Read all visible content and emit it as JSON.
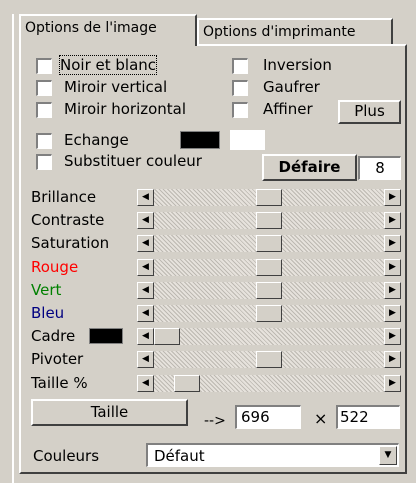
{
  "tabs": [
    {
      "label": "Options de l'image",
      "active": true
    },
    {
      "label": "Options d'imprimante",
      "active": false
    }
  ],
  "checkboxes": {
    "noir_et_blanc": "Noir et blanc",
    "inversion": "Inversion",
    "miroir_vertical": "Miroir vertical",
    "gaufrer": "Gaufrer",
    "miroir_horizontal": "Miroir horizontal",
    "affiner": "Affiner",
    "echange": "Echange",
    "substituer_couleur": "Substituer couleur"
  },
  "buttons": {
    "plus": "Plus",
    "defaire": "Défaire",
    "taille": "Taille"
  },
  "defaire_count": "8",
  "swatch_colors": {
    "echange_primary": "#000000",
    "echange_secondary": "#ffffff",
    "cadre": "#000000"
  },
  "sliders": [
    {
      "label": "Brillance",
      "color": "#000000",
      "value": 0.5
    },
    {
      "label": "Contraste",
      "color": "#000000",
      "value": 0.5
    },
    {
      "label": "Saturation",
      "color": "#000000",
      "value": 0.5
    },
    {
      "label": "Rouge",
      "color": "#ff0000",
      "value": 0.5
    },
    {
      "label": "Vert",
      "color": "#008000",
      "value": 0.5
    },
    {
      "label": "Bleu",
      "color": "#000080",
      "value": 0.5
    },
    {
      "label": "Cadre",
      "color": "#000000",
      "value": 0.0
    },
    {
      "label": "Pivoter",
      "color": "#000000",
      "value": 0.5
    },
    {
      "label": "Taille %",
      "color": "#000000",
      "value": 0.1
    }
  ],
  "size": {
    "arrow": "-->",
    "width": "696",
    "times": "×",
    "height": "522"
  },
  "couleurs": {
    "label": "Couleurs",
    "value": "Défaut"
  }
}
